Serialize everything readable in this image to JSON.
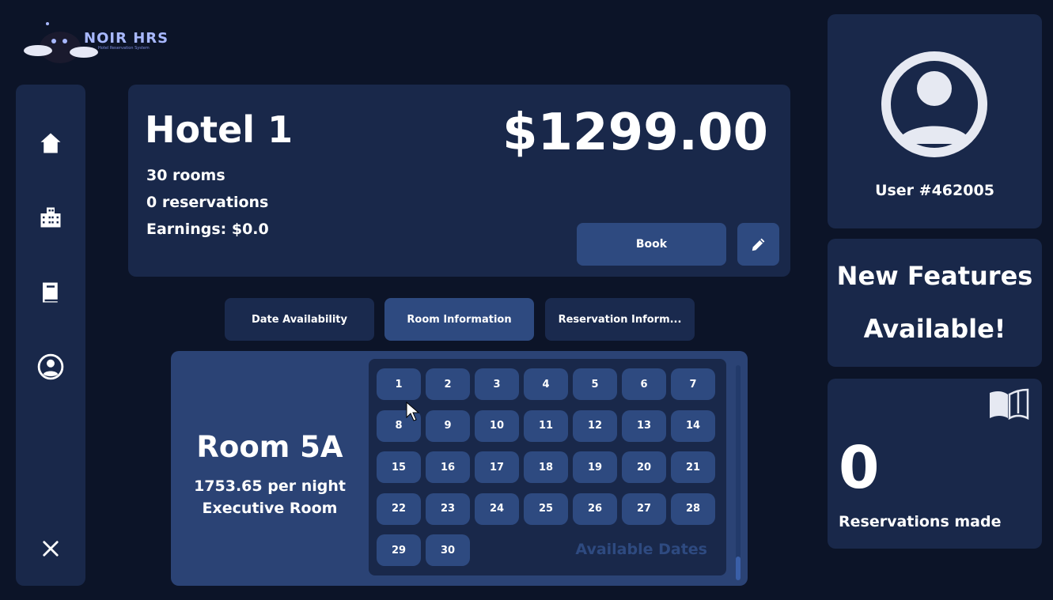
{
  "app": {
    "name": "NOIR HRS",
    "subtitle": "Hotel Reservation System"
  },
  "sidebar": {
    "items": [
      {
        "icon": "home-icon"
      },
      {
        "icon": "building-icon"
      },
      {
        "icon": "book-icon"
      },
      {
        "icon": "user-circle-icon"
      }
    ],
    "close_icon": "close-icon"
  },
  "hotel": {
    "name": "Hotel 1",
    "price": "$1299.00",
    "rooms": "30 rooms",
    "reservations": "0 reservations",
    "earnings": "Earnings: $0.0",
    "book_label": "Book",
    "edit_icon": "pencil-icon"
  },
  "tabs": [
    {
      "label": "Date Availability",
      "active": false
    },
    {
      "label": "Room Information",
      "active": true
    },
    {
      "label": "Reservation Inform...",
      "active": false
    }
  ],
  "room": {
    "name": "Room 5A",
    "price": "1753.65 per night",
    "type": "Executive Room",
    "dates": [
      "1",
      "2",
      "3",
      "4",
      "5",
      "6",
      "7",
      "8",
      "9",
      "10",
      "11",
      "12",
      "13",
      "14",
      "15",
      "16",
      "17",
      "18",
      "19",
      "20",
      "21",
      "22",
      "23",
      "24",
      "25",
      "26",
      "27",
      "28",
      "29",
      "30"
    ],
    "available_label": "Available Dates"
  },
  "user": {
    "label": "User #462005"
  },
  "features": {
    "line1": "New Features",
    "line2": "Available!"
  },
  "reservations_made": {
    "count": "0",
    "label": "Reservations made"
  },
  "colors": {
    "background": "#0c1428",
    "panel": "#19284a",
    "accent": "#2e4a80",
    "room_card": "#2b4375"
  }
}
